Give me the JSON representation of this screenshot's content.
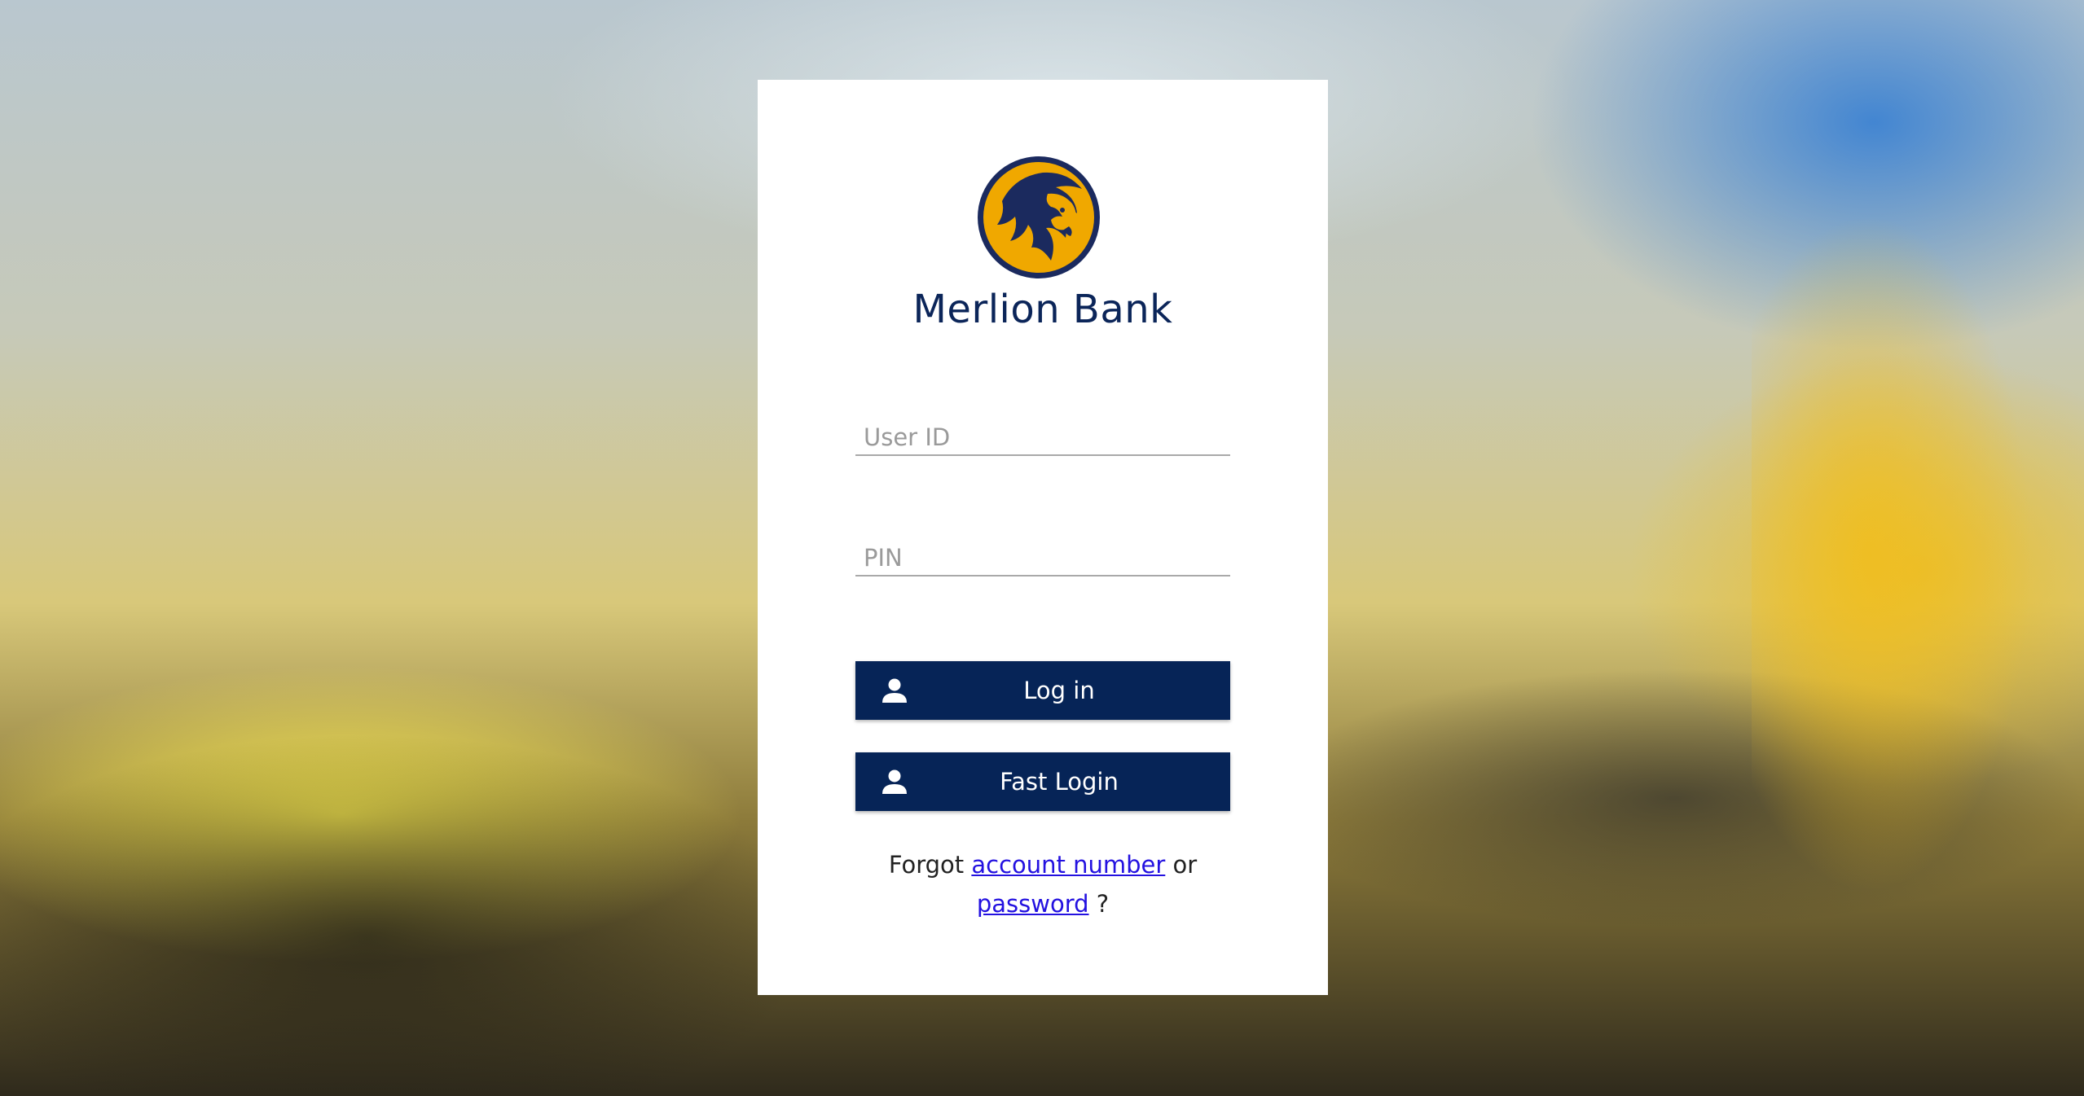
{
  "brand": {
    "name": "Merlion Bank",
    "logo_icon": "lion-head-logo-icon",
    "primary_color": "#062457",
    "logo_gold": "#f0a800"
  },
  "login_form": {
    "user_id_placeholder": "User ID",
    "user_id_value": "",
    "pin_placeholder": "PIN",
    "pin_value": ""
  },
  "buttons": {
    "login": {
      "label": "Log in",
      "icon": "person-icon"
    },
    "fast_login": {
      "label": "Fast Login",
      "icon": "person-icon"
    }
  },
  "forgot": {
    "prefix": "Forgot",
    "account_link": "account number",
    "middle": "or",
    "password_link": "password",
    "suffix": "?"
  }
}
